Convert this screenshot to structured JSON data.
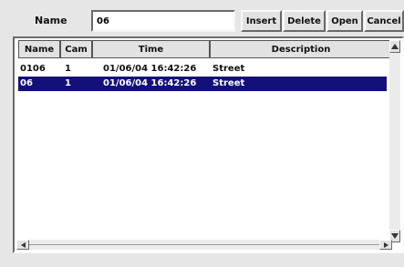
{
  "top_bar": {
    "name_label": "Name",
    "name_value": "06"
  },
  "buttons": {
    "insert": "Insert",
    "delete": "Delete",
    "open": "Open",
    "cancel": "Cancel"
  },
  "table": {
    "columns": [
      "Name",
      "Cam",
      "Time",
      "Description"
    ],
    "rows": [
      {
        "name": "0106",
        "cam": "1",
        "time": "01/06/04 16:42:26",
        "description": "Street",
        "selected": false
      },
      {
        "name": "06",
        "cam": "1",
        "time": "01/06/04 16:42:26",
        "description": "Street",
        "selected": true
      }
    ]
  },
  "colors": {
    "selection_bg": "#14107a",
    "selection_fg": "#ffffff",
    "window_bg": "#e6e6e6"
  }
}
